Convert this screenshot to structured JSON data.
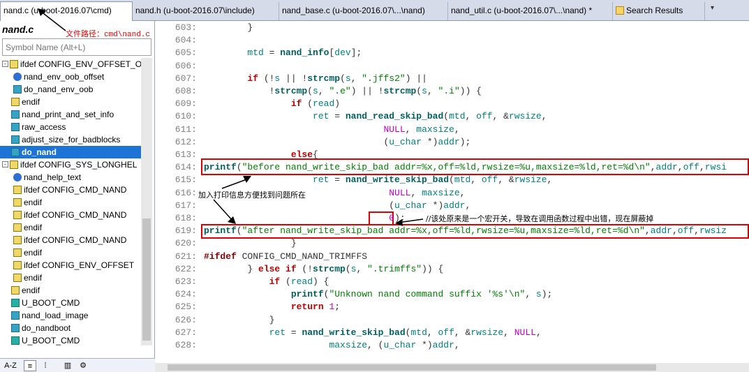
{
  "tabs": [
    {
      "label": "nand.c (u-boot-2016.07\\cmd)",
      "active": true
    },
    {
      "label": "nand.h (u-boot-2016.07\\include)"
    },
    {
      "label": "nand_base.c (u-boot-2016.07\\...\\nand)"
    },
    {
      "label": "nand_util.c (u-boot-2016.07\\...\\nand) *"
    },
    {
      "label": "Search Results"
    }
  ],
  "tab_dropdown": "▾",
  "left_panel": {
    "file_title": "nand.c",
    "path_note": "文件路径：cmd\\nand.c",
    "search_placeholder": "Symbol Name (Alt+L)",
    "tree": [
      {
        "label": "ifdef CONFIG_ENV_OFFSET_O",
        "icon": "hash",
        "level": 0,
        "expander": "-"
      },
      {
        "label": "nand_env_oob_offset",
        "icon": "func",
        "level": 1
      },
      {
        "label": "do_nand_env_oob",
        "icon": "var",
        "level": 1
      },
      {
        "label": "endif",
        "icon": "hash",
        "level": 0
      },
      {
        "label": "nand_print_and_set_info",
        "icon": "var",
        "level": 0
      },
      {
        "label": "raw_access",
        "icon": "var",
        "level": 0
      },
      {
        "label": "adjust_size_for_badblocks",
        "icon": "var",
        "level": 0
      },
      {
        "label": "do_nand",
        "icon": "var",
        "level": 0,
        "selected": true
      },
      {
        "label": "ifdef CONFIG_SYS_LONGHEL",
        "icon": "hash",
        "level": 0,
        "expander": "-"
      },
      {
        "label": "nand_help_text",
        "icon": "func",
        "level": 1
      },
      {
        "label": "ifdef CONFIG_CMD_NAND",
        "icon": "hash",
        "level": 1
      },
      {
        "label": "endif",
        "icon": "hash",
        "level": 1
      },
      {
        "label": "ifdef CONFIG_CMD_NAND",
        "icon": "hash",
        "level": 1
      },
      {
        "label": "endif",
        "icon": "hash",
        "level": 1
      },
      {
        "label": "ifdef CONFIG_CMD_NAND",
        "icon": "hash",
        "level": 1
      },
      {
        "label": "endif",
        "icon": "hash",
        "level": 1
      },
      {
        "label": "ifdef CONFIG_ENV_OFFSET",
        "icon": "hash",
        "level": 1
      },
      {
        "label": "endif",
        "icon": "hash",
        "level": 1
      },
      {
        "label": "endif",
        "icon": "hash",
        "level": 0
      },
      {
        "label": "U_BOOT_CMD",
        "icon": "var2",
        "level": 0
      },
      {
        "label": "nand_load_image",
        "icon": "var",
        "level": 0
      },
      {
        "label": "do_nandboot",
        "icon": "var",
        "level": 0
      },
      {
        "label": "U_BOOT_CMD",
        "icon": "var2",
        "level": 0
      }
    ],
    "toolbar": [
      "A-Z",
      "≡",
      "⁞",
      "▥",
      "⚙"
    ]
  },
  "editor": {
    "annotation_left": "加入打印信息方便找到问题所在",
    "annotation_right": "//该处原来是一个宏开关，导致在调用函数过程中出错，现在屏蔽掉",
    "lines": [
      {
        "n": "603:",
        "code": [
          [
            "gray",
            "        }"
          ]
        ]
      },
      {
        "n": "604:",
        "code": []
      },
      {
        "n": "605:",
        "code": [
          [
            "var",
            "        mtd"
          ],
          [
            "gray",
            " = "
          ],
          [
            "fn",
            "nand_info"
          ],
          [
            "gray",
            "["
          ],
          [
            "var",
            "dev"
          ],
          [
            "gray",
            "];"
          ]
        ]
      },
      {
        "n": "606:",
        "code": []
      },
      {
        "n": "607:",
        "code": [
          [
            "kw",
            "        if"
          ],
          [
            "gray",
            " (!"
          ],
          [
            "var",
            "s"
          ],
          [
            "gray",
            " || !"
          ],
          [
            "fn",
            "strcmp"
          ],
          [
            "gray",
            "("
          ],
          [
            "var",
            "s"
          ],
          [
            "gray",
            ", "
          ],
          [
            "str",
            "\".jffs2\""
          ],
          [
            "gray",
            ") ||"
          ]
        ]
      },
      {
        "n": "608:",
        "code": [
          [
            "gray",
            "            !"
          ],
          [
            "fn",
            "strcmp"
          ],
          [
            "gray",
            "("
          ],
          [
            "var",
            "s"
          ],
          [
            "gray",
            ", "
          ],
          [
            "str",
            "\".e\""
          ],
          [
            "gray",
            ") || !"
          ],
          [
            "fn",
            "strcmp"
          ],
          [
            "gray",
            "("
          ],
          [
            "var",
            "s"
          ],
          [
            "gray",
            ", "
          ],
          [
            "str",
            "\".i\""
          ],
          [
            "gray",
            ")) {"
          ]
        ]
      },
      {
        "n": "609:",
        "code": [
          [
            "kw",
            "                if"
          ],
          [
            "gray",
            " ("
          ],
          [
            "var",
            "read"
          ],
          [
            "gray",
            ")"
          ]
        ]
      },
      {
        "n": "610:",
        "code": [
          [
            "var",
            "                    ret"
          ],
          [
            "gray",
            " = "
          ],
          [
            "fn",
            "nand_read_skip_bad"
          ],
          [
            "gray",
            "("
          ],
          [
            "var",
            "mtd"
          ],
          [
            "gray",
            ", "
          ],
          [
            "var",
            "off"
          ],
          [
            "gray",
            ", &"
          ],
          [
            "var",
            "rwsize"
          ],
          [
            "gray",
            ","
          ]
        ]
      },
      {
        "n": "611:",
        "code": [
          [
            "nm",
            "                                 NULL"
          ],
          [
            "gray",
            ", "
          ],
          [
            "var",
            "maxsize"
          ],
          [
            "gray",
            ","
          ]
        ]
      },
      {
        "n": "612:",
        "code": [
          [
            "gray",
            "                                 ("
          ],
          [
            "var",
            "u_char"
          ],
          [
            "gray",
            " *)"
          ],
          [
            "var",
            "addr"
          ],
          [
            "gray",
            ");"
          ]
        ]
      },
      {
        "n": "613:",
        "code": [
          [
            "kw",
            "                else"
          ],
          [
            "gray",
            "{"
          ]
        ]
      },
      {
        "n": "614:",
        "code": [
          [
            "fn",
            "printf"
          ],
          [
            "gray",
            "("
          ],
          [
            "str",
            "\"before nand_write_skip_bad addr=%x,off=%ld,rwsize=%u,maxsize=%ld,ret=%d\\n\""
          ],
          [
            "gray",
            ","
          ],
          [
            "var",
            "addr"
          ],
          [
            "gray",
            ","
          ],
          [
            "var",
            "off"
          ],
          [
            "gray",
            ","
          ],
          [
            "var",
            "rwsi"
          ]
        ],
        "box": true
      },
      {
        "n": "615:",
        "code": [
          [
            "var",
            "                    ret"
          ],
          [
            "gray",
            " = "
          ],
          [
            "fn",
            "nand_write_skip_bad"
          ],
          [
            "gray",
            "("
          ],
          [
            "var",
            "mtd"
          ],
          [
            "gray",
            ", "
          ],
          [
            "var",
            "off"
          ],
          [
            "gray",
            ", &"
          ],
          [
            "var",
            "rwsize"
          ],
          [
            "gray",
            ","
          ]
        ]
      },
      {
        "n": "616:",
        "code": [
          [
            "nm",
            "                                  NULL"
          ],
          [
            "gray",
            ", "
          ],
          [
            "var",
            "maxsize"
          ],
          [
            "gray",
            ","
          ]
        ]
      },
      {
        "n": "617:",
        "code": [
          [
            "gray",
            "                                  ("
          ],
          [
            "var",
            "u_char"
          ],
          [
            "gray",
            " *)"
          ],
          [
            "var",
            "addr"
          ],
          [
            "gray",
            ","
          ]
        ]
      },
      {
        "n": "618:",
        "code": [
          [
            "gray",
            "                                  "
          ],
          [
            "nm",
            "0"
          ],
          [
            "gray",
            ");"
          ]
        ]
      },
      {
        "n": "619:",
        "code": [
          [
            "fn",
            "printf"
          ],
          [
            "gray",
            "("
          ],
          [
            "str",
            "\"after nand_write_skip_bad addr=%x,off=%ld,rwsize=%u,maxsize=%ld,ret=%d\\n\""
          ],
          [
            "gray",
            ","
          ],
          [
            "var",
            "addr"
          ],
          [
            "gray",
            ","
          ],
          [
            "var",
            "off"
          ],
          [
            "gray",
            ","
          ],
          [
            "var",
            "rwsiz"
          ]
        ],
        "box": true
      },
      {
        "n": "620:",
        "code": [
          [
            "gray",
            "                }"
          ]
        ]
      },
      {
        "n": "621:",
        "code": [
          [
            "mac",
            "#ifdef"
          ],
          [
            "gray",
            " CONFIG_CMD_NAND_TRIMFFS"
          ]
        ]
      },
      {
        "n": "622:",
        "code": [
          [
            "gray",
            "        } "
          ],
          [
            "kw",
            "else if"
          ],
          [
            "gray",
            " (!"
          ],
          [
            "fn",
            "strcmp"
          ],
          [
            "gray",
            "("
          ],
          [
            "var",
            "s"
          ],
          [
            "gray",
            ", "
          ],
          [
            "str",
            "\".trimffs\""
          ],
          [
            "gray",
            ")) {"
          ]
        ]
      },
      {
        "n": "623:",
        "code": [
          [
            "kw",
            "            if"
          ],
          [
            "gray",
            " ("
          ],
          [
            "var",
            "read"
          ],
          [
            "gray",
            ") {"
          ]
        ]
      },
      {
        "n": "624:",
        "code": [
          [
            "fn",
            "                printf"
          ],
          [
            "gray",
            "("
          ],
          [
            "str",
            "\"Unknown nand command suffix '%s'\\n\""
          ],
          [
            "gray",
            ", "
          ],
          [
            "var",
            "s"
          ],
          [
            "gray",
            ");"
          ]
        ]
      },
      {
        "n": "625:",
        "code": [
          [
            "kw",
            "                return"
          ],
          [
            "gray",
            " "
          ],
          [
            "nm",
            "1"
          ],
          [
            "gray",
            ";"
          ]
        ]
      },
      {
        "n": "626:",
        "code": [
          [
            "gray",
            "            }"
          ]
        ]
      },
      {
        "n": "627:",
        "code": [
          [
            "var",
            "            ret"
          ],
          [
            "gray",
            " = "
          ],
          [
            "fn",
            "nand_write_skip_bad"
          ],
          [
            "gray",
            "("
          ],
          [
            "var",
            "mtd"
          ],
          [
            "gray",
            ", "
          ],
          [
            "var",
            "off"
          ],
          [
            "gray",
            ", &"
          ],
          [
            "var",
            "rwsize"
          ],
          [
            "gray",
            ", "
          ],
          [
            "nm",
            "NULL"
          ],
          [
            "gray",
            ","
          ]
        ]
      },
      {
        "n": "628:",
        "code": [
          [
            "gray",
            "                       "
          ],
          [
            "var",
            "maxsize"
          ],
          [
            "gray",
            ", ("
          ],
          [
            "var",
            "u_char"
          ],
          [
            "gray",
            " *)"
          ],
          [
            "var",
            "addr"
          ],
          [
            "gray",
            ","
          ]
        ]
      }
    ]
  }
}
